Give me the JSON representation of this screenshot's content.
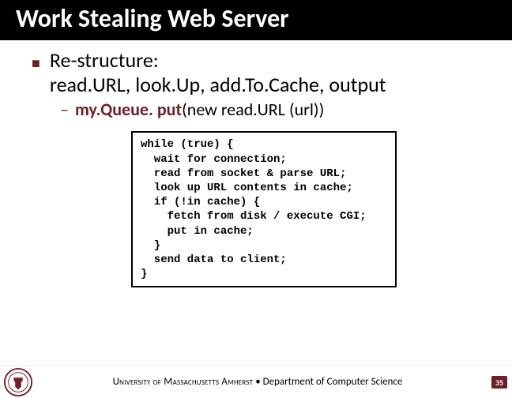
{
  "title": "Work Stealing Web Server",
  "bullet1": {
    "line1": "Re-structure:",
    "line2": "read.URL, look.Up, add.To.Cache, output"
  },
  "bullet2": {
    "dash": "–",
    "bold": "my.Queue. put",
    "rest": "(new read.URL (url))"
  },
  "code": "while (true) {\n  wait for connection;\n  read from socket & parse URL;\n  look up URL contents in cache;\n  if (!in cache) {\n    fetch from disk / execute CGI;\n    put in cache;\n  }\n  send data to client;\n}",
  "footer": {
    "university": "University of Massachusetts Amherst",
    "sep": "•",
    "dept": "Department of Computer Science",
    "page": "35"
  },
  "icons": {
    "square_bullet": "■"
  }
}
